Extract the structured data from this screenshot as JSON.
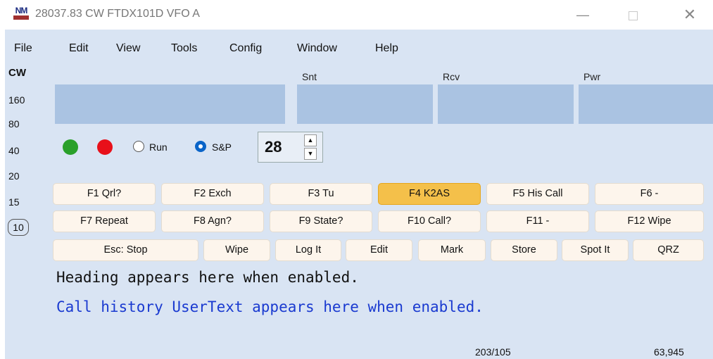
{
  "titlebar": {
    "logo_text": "NM",
    "title": "28037.83 CW FTDX101D VFO A",
    "minimize_glyph": "—",
    "close_glyph": "✕"
  },
  "menu": [
    "File",
    "Edit",
    "View",
    "Tools",
    "Config",
    "Window",
    "Help"
  ],
  "mode": "CW",
  "bands": [
    "160",
    "80",
    "40",
    "20",
    "15",
    "10"
  ],
  "selected_band": "10",
  "fields": {
    "snt_label": "Snt",
    "rcv_label": "Rcv",
    "pwr_label": "Pwr"
  },
  "indicators": {
    "green": "#2aa02a",
    "red": "#e8101a"
  },
  "mode_radio": {
    "run_label": "Run",
    "sp_label": "S&P",
    "selected": "S&P"
  },
  "spinner": {
    "value": "28",
    "up_glyph": "▲",
    "down_glyph": "▼"
  },
  "fkeys_row1": [
    "F1 Qrl?",
    "F2 Exch",
    "F3 Tu",
    "F4 K2AS",
    "F5 His Call",
    "F6 -"
  ],
  "fkeys_row2": [
    "F7 Repeat",
    "F8 Agn?",
    "F9 State?",
    "F10 Call?",
    "F11 -",
    "F12 Wipe"
  ],
  "buttons_row3": [
    "Esc: Stop",
    "Wipe",
    "Log It",
    "Edit",
    "Mark",
    "Store",
    "Spot It",
    "QRZ"
  ],
  "active_key": "F4 K2AS",
  "heading_text": "Heading appears here when enabled.",
  "usertext": "Call history UserText appears here when enabled.",
  "usertext_color": "#1a3ad0",
  "status": {
    "qso": "203/105",
    "score": "63,945"
  }
}
